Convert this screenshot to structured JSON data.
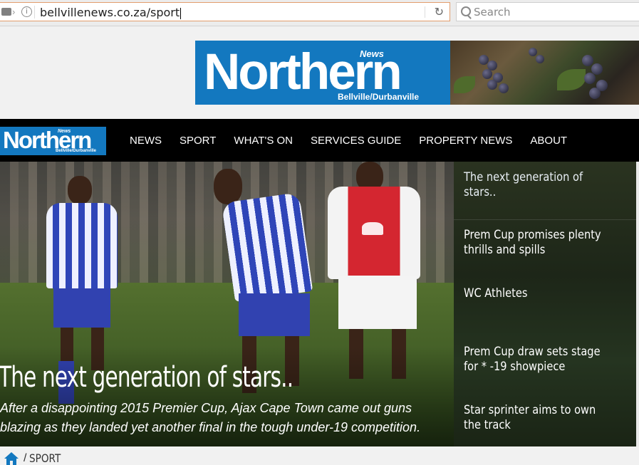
{
  "browser": {
    "url": "bellvillenews.co.za/sport",
    "search_placeholder": "Search"
  },
  "banner": {
    "logo_news": "News",
    "logo_title": "Northern",
    "logo_sub": "Bellville/Durbanville"
  },
  "nav": {
    "logo_news": "News",
    "logo_title": "Northern",
    "logo_sub": "Bellville/Durbanville",
    "items": [
      {
        "label": "NEWS"
      },
      {
        "label": "SPORT"
      },
      {
        "label": "WHAT'S ON"
      },
      {
        "label": "SERVICES GUIDE"
      },
      {
        "label": "PROPERTY NEWS"
      },
      {
        "label": "ABOUT"
      }
    ]
  },
  "hero": {
    "title": "The next generation of stars..",
    "description": "After a disappointing 2015 Premier Cup, Ajax Cape Town came out guns blazing as they landed yet another final in the tough under-19 competition."
  },
  "sidebar": {
    "items": [
      {
        "title": "The next generation of stars.."
      },
      {
        "title": "Prem Cup promises plenty thrills and spills"
      },
      {
        "title": "WC Athletes"
      },
      {
        "title": "Prem Cup draw sets stage for * -19 showpiece"
      },
      {
        "title": "Star sprinter aims to own the track"
      }
    ]
  },
  "breadcrumb": {
    "separator": "/",
    "current": "SPORT"
  },
  "colors": {
    "brand_blue": "#1378bf",
    "nav_bg": "#000000"
  }
}
